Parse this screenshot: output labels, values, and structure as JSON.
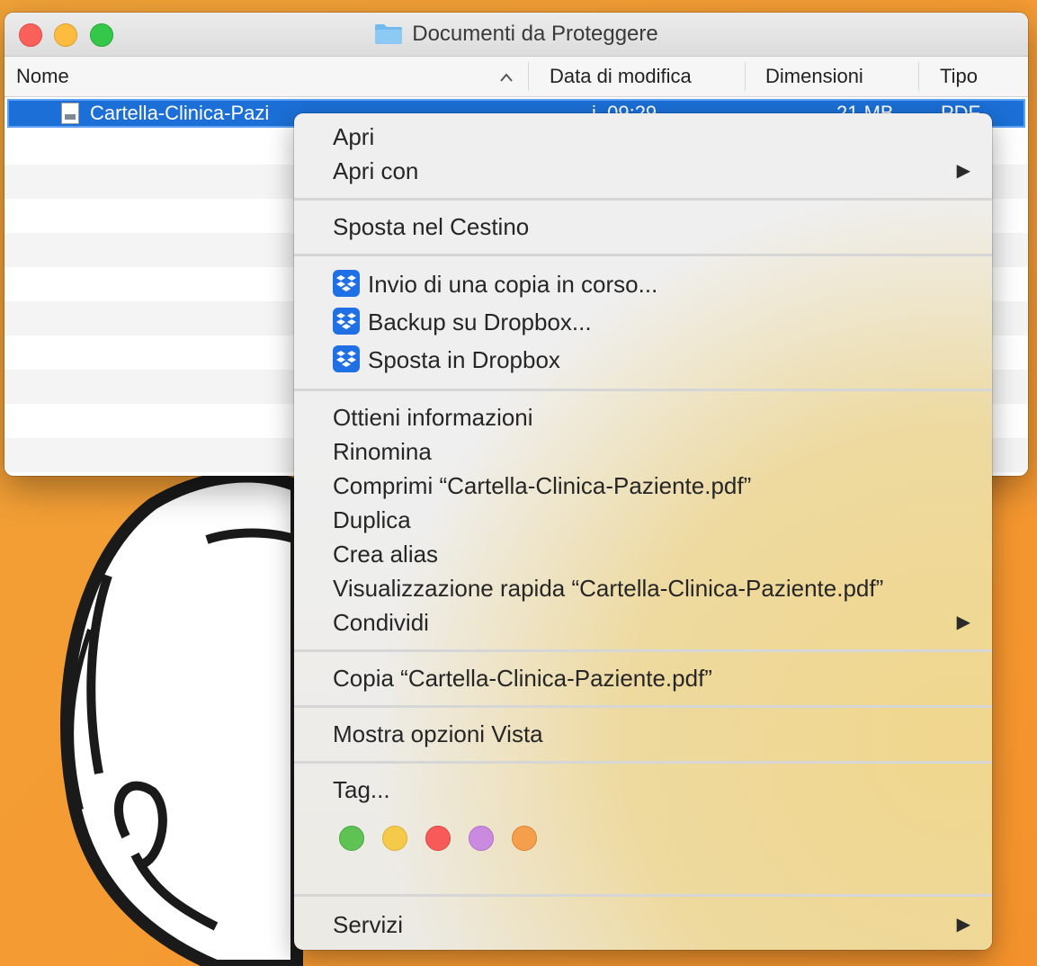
{
  "window": {
    "title": "Documenti da Proteggere",
    "columns": {
      "name": "Nome",
      "date": "Data di modifica",
      "size": "Dimensioni",
      "type": "Tipo"
    },
    "selected_file": {
      "name": "Cartella-Clinica-Pazi",
      "date": "i, 09:29",
      "size": "21 MB",
      "type": "PDF"
    }
  },
  "menu": {
    "open": "Apri",
    "open_with": "Apri con",
    "trash": "Sposta nel Cestino",
    "dropbox_send": "Invio di una copia in corso...",
    "dropbox_backup": "Backup su Dropbox...",
    "dropbox_move": "Sposta in Dropbox",
    "get_info": "Ottieni informazioni",
    "rename": "Rinomina",
    "compress": "Comprimi “Cartella-Clinica-Paziente.pdf”",
    "duplicate": "Duplica",
    "make_alias": "Crea alias",
    "quick_look": "Visualizzazione rapida “Cartella-Clinica-Paziente.pdf”",
    "share": "Condividi",
    "copy": "Copia “Cartella-Clinica-Paziente.pdf”",
    "view_options": "Mostra opzioni Vista",
    "tags": "Tag...",
    "services": "Servizi",
    "submenu_arrow": "▶",
    "tag_colors": [
      "#5ec353",
      "#f5c94a",
      "#f85a5a",
      "#c98ae0",
      "#f59e4b"
    ]
  },
  "icons": {
    "sort": "chevron-up-icon",
    "folder": "folder-icon",
    "file": "pdf-file-icon",
    "dropbox": "dropbox-icon"
  }
}
